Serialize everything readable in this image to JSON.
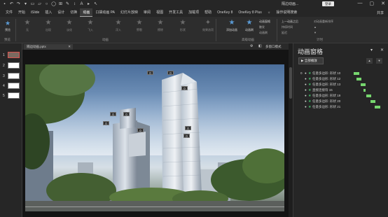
{
  "title_bar": {
    "quick_access": [
      "save-icon",
      "undo-icon",
      "redo-icon",
      "format-icon",
      "shape-icon",
      "shape-icon",
      "circle-icon",
      "circle-icon",
      "table-icon",
      "pen-icon",
      "arrow-icon",
      "text-icon",
      "start-icon",
      "pointer-icon"
    ],
    "doc_title": "隔边动画...",
    "login_button": "登录",
    "window_controls": [
      "—",
      "▢",
      "✕"
    ]
  },
  "menu": {
    "items": [
      "文件",
      "开始",
      "iSlide",
      "插入",
      "设计",
      "切换",
      "动画",
      "口袋动画 PA",
      "幻灯片放映",
      "审阅",
      "视图",
      "开发工具",
      "加载项",
      "帮助",
      "OneKey 8",
      "OneKey 8 Plus",
      "操作说明搜索"
    ],
    "active": "动画",
    "search_icon": "lightbulb-icon",
    "share_label": "共享"
  },
  "ribbon": {
    "preview_label": "预览",
    "effects": [
      "无",
      "出现",
      "淡化",
      "飞入",
      "浮入",
      "劈裂",
      "擦除",
      "形状"
    ],
    "effect_options_label": "效果选项",
    "add_animation_label": "添加动画",
    "anim_painter_label": "动画刷",
    "group_labels": [
      "预览",
      "动画",
      "高级动画",
      "计时"
    ],
    "advanced_options": [
      "动画窗格",
      "触发",
      "动画刷"
    ],
    "timing": {
      "start_label": "上一动画之后",
      "reorder_label": "对动画重新排序",
      "duration_label": "持续时间",
      "delay_label": "延迟"
    }
  },
  "slides": {
    "numbers": [
      "1",
      "2",
      "3",
      "4",
      "5"
    ]
  },
  "document_tab": {
    "name": "隔边动画.pptx",
    "multi_window": "多窗口模式"
  },
  "canvas": {
    "tags": [
      "0",
      "0",
      "0",
      "0",
      "0",
      "0",
      "0",
      "0",
      "0"
    ]
  },
  "animation_pane": {
    "title": "动画窗格",
    "play_all": "全部播放",
    "items": [
      {
        "num": "0",
        "text": "任意多边形: 形状 10"
      },
      {
        "num": "",
        "text": "任意多边形: 形状 12"
      },
      {
        "num": "",
        "text": "任意多边形: 形状 13"
      },
      {
        "num": "",
        "text": "直接连接符 15"
      },
      {
        "num": "",
        "text": "任意多边形: 形状 19"
      },
      {
        "num": "",
        "text": "任意多边形: 形状 20"
      },
      {
        "num": "",
        "text": "任意多边形: 形状 21"
      }
    ]
  },
  "colors": {
    "accent_blue": "#5b9bd5",
    "timeline_green": "#76d66e",
    "star_green": "#3fbf6a",
    "selected_border": "#d9534f"
  }
}
